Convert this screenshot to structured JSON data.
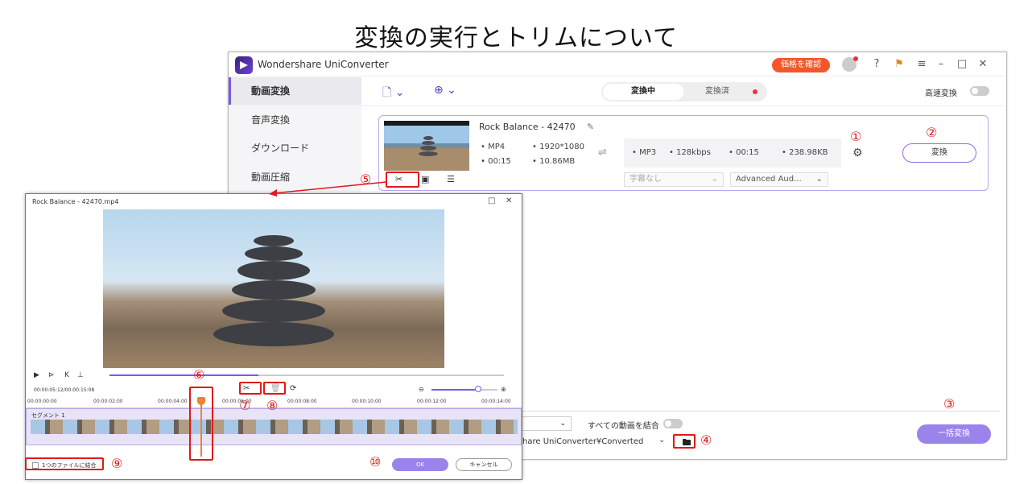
{
  "page_title": "変換の実行とトリムについて",
  "app": {
    "name": "Wondershare UniConverter",
    "price_button": "価格を確認",
    "sidebar": [
      {
        "label": "動画変換",
        "active": true
      },
      {
        "label": "音声変換",
        "active": false
      },
      {
        "label": "ダウンロード",
        "active": false
      },
      {
        "label": "動画圧縮",
        "active": false
      }
    ],
    "tabs": {
      "converting": "変換中",
      "converted": "変換済"
    },
    "high_speed_label": "高速変換",
    "file": {
      "title": "Rock Balance - 42470",
      "source_format": "MP4",
      "source_resolution": "1920*1080",
      "source_duration": "00:15",
      "source_size": "10.86MB",
      "target_format": "MP3",
      "target_bitrate": "128kbps",
      "target_duration": "00:15",
      "target_size": "238.98KB",
      "subtitle_dropdown": "字幕なし",
      "audio_dropdown": "Advanced Aud..."
    },
    "convert_button": "変換",
    "merge_label": "すべての動画を結合",
    "output_path": "hare UniConverter¥Converted",
    "batch_convert_button": "一括変換"
  },
  "trim_dialog": {
    "title": "Rock Balance - 42470.mp4",
    "current_time": "00:00:05:12/00:00:15:08",
    "ruler_ticks": [
      "00:00:00:00",
      "00:00:02:00",
      "00:00:04:00",
      "00:00:06:00",
      "00:00:08:00",
      "00:00:10:00",
      "00:00:12:00",
      "00:00:14:00"
    ],
    "segment_label": "セグメント 1",
    "combine_label": "1つのファイルに結合",
    "ok_button": "OK",
    "cancel_button": "キャンセル"
  },
  "annotations": [
    "①",
    "②",
    "③",
    "④",
    "⑤",
    "⑥",
    "⑦",
    "⑧",
    "⑨",
    "⑩"
  ],
  "colors": {
    "accent": "#7d59e6",
    "annotation_red": "#e01919",
    "price_orange": "#f2572a",
    "playhead": "#f0812d"
  }
}
